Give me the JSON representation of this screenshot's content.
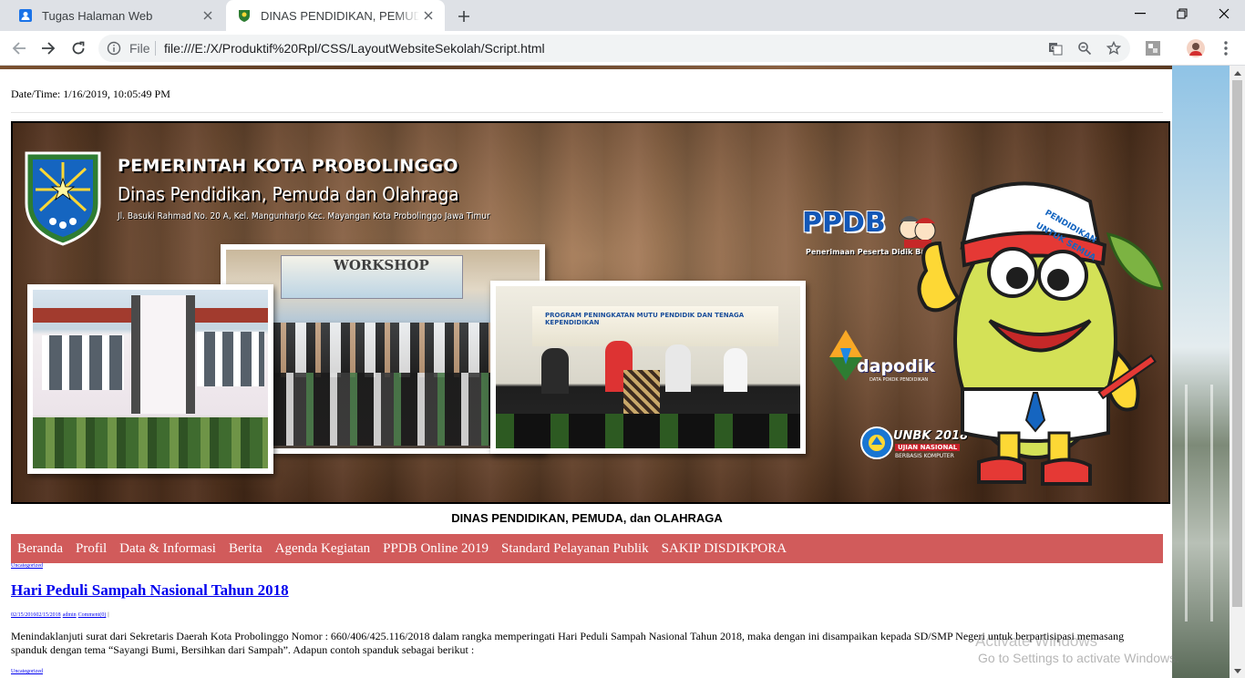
{
  "browser": {
    "tabs": [
      {
        "title": "Tugas Halaman Web",
        "favicon": "contacts-icon",
        "active": false
      },
      {
        "title": "DINAS PENDIDIKAN, PEMUDA dan OLAHRAGA",
        "favicon": "crest-icon",
        "active": true
      }
    ],
    "address": {
      "scheme_label": "File",
      "url": "file:///E:/X/Produktif%20Rpl/CSS/LayoutWebsiteSekolah/Script.html"
    }
  },
  "page": {
    "datetime": "Date/Time: 1/16/2019, 10:05:49 PM",
    "banner": {
      "title1": "PEMERINTAH KOTA PROBOLINGGO",
      "title2": "Dinas Pendidikan, Pemuda dan Olahraga",
      "address": "Jl. Basuki Rahmad No. 20 A, Kel. Mangunharjo Kec. Mayangan Kota Probolinggo Jawa Timur",
      "workshop_sign": "WORKSHOP",
      "ppdb": "PPDB",
      "ppdb_sub": "Penerimaan Peserta Didik Baru",
      "dapodik": "dapodik",
      "dapodik_sub": "DATA POKOK PENDIDIKAN",
      "unbk": "UNBK 2018",
      "unbk_sub1": "UJIAN NASIONAL",
      "unbk_sub2": "BERBASIS KOMPUTER",
      "mascot_hat": "PENDIDIKAN UNTUK SEMUA"
    },
    "caption": "DINAS PENDIDIKAN, PEMUDA, dan OLAHRAGA",
    "nav": [
      "Beranda",
      "Profil",
      "Data & Informasi",
      "Berita",
      "Agenda Kegiatan",
      "PPDB Online 2019",
      "Standard Pelayanan Publik",
      "SAKIP DISDIKPORA"
    ],
    "post": {
      "category": "Uncategorized",
      "title": "Hari Peduli Sampah Nasional Tahun 2018",
      "meta_date": "02/15/201602/15/2018",
      "meta_author": "admin",
      "meta_comments": "Comment(0)",
      "body": "Menindaklanjuti surat dari Sekretaris Daerah Kota Probolinggo Nomor : 660/406/425.116/2018 dalam rangka memperingati Hari Peduli Sampah Nasional Tahun 2018, maka dengan ini disampaikan kepada SD/SMP Negeri untuk berpartisipasi memasang spanduk dengan tema “Sayangi Bumi, Bersihkan dari Sampah”. Adapun contoh spanduk sebagai berikut :",
      "next_category": "Uncategorized"
    }
  },
  "os": {
    "activate_title": "Activate Windows",
    "activate_sub": "Go to Settings to activate Windows."
  },
  "colors": {
    "nav_bg": "#d15b5b",
    "link": "#0000ee",
    "tabstrip": "#dee1e6"
  }
}
